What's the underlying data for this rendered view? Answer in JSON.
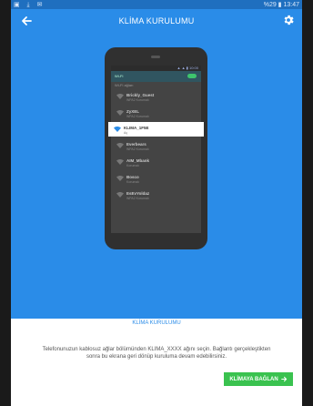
{
  "status_bar": {
    "left_icons": "▣ ⤓ ✉",
    "right_text": "%29 ▮ 13:47"
  },
  "app_bar": {
    "title": "KLİMA KURULUMU"
  },
  "illustration": {
    "phone_status": "▲ ▲ ▮ 10:00",
    "wifi_header": "Wi-Fi",
    "subheader": "Wi-Fi ağları",
    "networks": [
      {
        "name": "Brickly_Guest",
        "sub": "WPA2 Korumalı"
      },
      {
        "name": "ZyXEL",
        "sub": "WPA2 Korumalı"
      },
      {
        "name": "KLIMA_1F5E",
        "sub": "Aç",
        "highlight": true
      },
      {
        "name": "Everbears",
        "sub": "WPA2 Korumalı"
      },
      {
        "name": "AIM_Mbank",
        "sub": "Korumalı"
      },
      {
        "name": "Bosco",
        "sub": "Korumalı"
      },
      {
        "name": "EsEvYoldaz",
        "sub": "WPA2 Korumalı"
      }
    ]
  },
  "bottom": {
    "section_title": "KLİMA KURULUMU",
    "description": "Telefonunuzun kablosuz ağlar bölümünden KLIMA_XXXX ağını seçin. Bağlantı gerçekleştikten sonra bu ekrana geri dönüp kuruluma devam edebilirsiniz.",
    "connect_label": "KLİMAYA BAĞLAN"
  },
  "colors": {
    "primary": "#2a8ce8",
    "button": "#3ac24f"
  }
}
